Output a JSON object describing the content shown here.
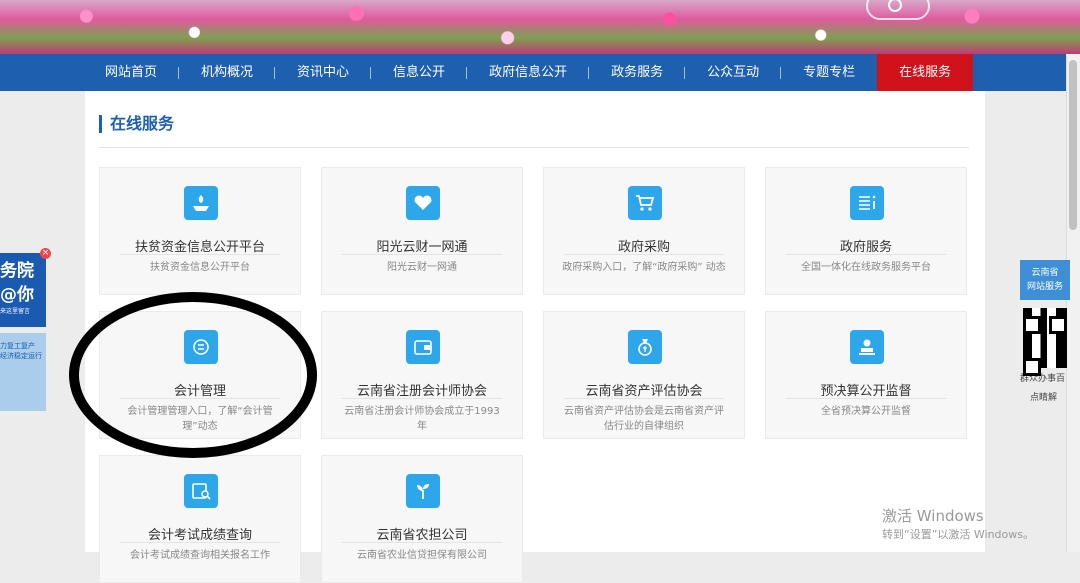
{
  "nav": {
    "items": [
      "网站首页",
      "机构概况",
      "资讯中心",
      "信息公开",
      "政府信息公开",
      "政务服务",
      "公众互动",
      "专题专栏",
      "在线服务"
    ],
    "active_index": 8
  },
  "section": {
    "title": "在线服务"
  },
  "cards": [
    {
      "title": "扶贫资金信息公开平台",
      "desc": "扶贫资金信息公开平台",
      "icon": "hand-plant-icon"
    },
    {
      "title": "阳光云财一网通",
      "desc": "阳光云财一网通",
      "icon": "heart-hands-icon"
    },
    {
      "title": "政府采购",
      "desc": "政府采购入口，了解“政府采购” 动态",
      "icon": "shopping-cart-icon"
    },
    {
      "title": "政府服务",
      "desc": "全国一体化在线政务服务平台",
      "icon": "list-info-icon"
    },
    {
      "title": "会计管理",
      "desc": "会计管理管理入口，了解“会计管理”动态",
      "icon": "accounting-icon"
    },
    {
      "title": "云南省注册会计师协会",
      "desc": "云南省注册会计师协会成立于1993年",
      "icon": "wallet-icon"
    },
    {
      "title": "云南省资产评估协会",
      "desc": "云南省资产评估协会是云南省资产评估行业的自律组织",
      "icon": "money-bag-icon"
    },
    {
      "title": "预决算公开监督",
      "desc": "全省预决算公开监督",
      "icon": "stamp-icon"
    },
    {
      "title": "会计考试成绩查询",
      "desc": "会计考试成绩查询相关报名工作",
      "icon": "search-document-icon"
    },
    {
      "title": "云南省农担公司",
      "desc": "云南省农业信贷担保有限公司",
      "icon": "sprout-icon"
    }
  ],
  "ad_left": {
    "line1": "务院",
    "line2": "@你",
    "line3": "来这里留言",
    "line4": "力复工复产",
    "line5": "经济稳定运行"
  },
  "ad_right": {
    "line1": "云南省",
    "line2": "网站服务",
    "cap1": "群众办事百",
    "cap2": "点睛解"
  },
  "watermark": {
    "line1": "激活 Windows",
    "line2": "转到“设置”以激活 Windows。"
  }
}
